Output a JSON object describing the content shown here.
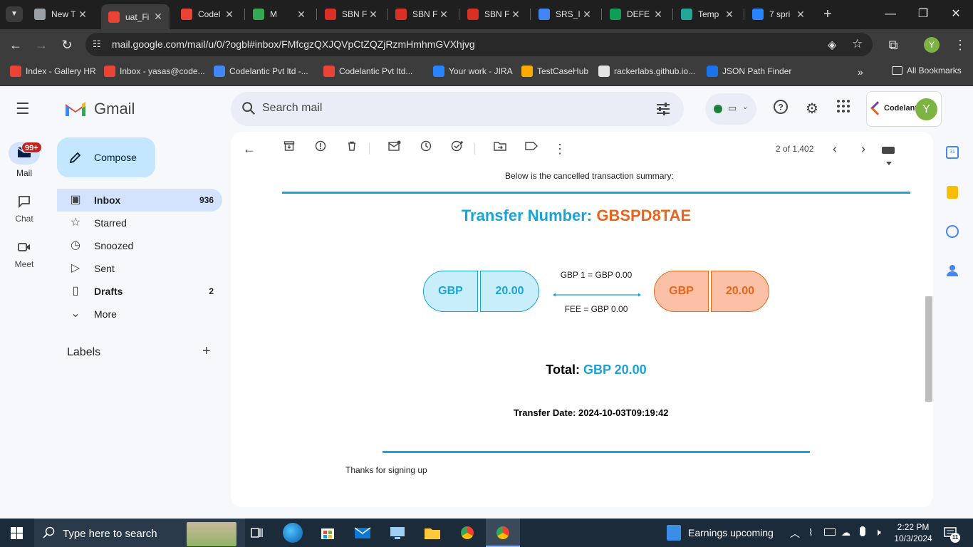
{
  "browser": {
    "tabs": [
      {
        "title": "New T",
        "color": "#9aa0a6"
      },
      {
        "title": "uat_Fi",
        "color": "#ea4335",
        "active": true
      },
      {
        "title": "Codel",
        "color": "#ea4335"
      },
      {
        "title": "M",
        "color": "#34a853"
      },
      {
        "title": "SBN F",
        "color": "#d93025"
      },
      {
        "title": "SBN F",
        "color": "#d93025"
      },
      {
        "title": "SBN F",
        "color": "#d93025"
      },
      {
        "title": "SRS_I",
        "color": "#4285f4"
      },
      {
        "title": "DEFE",
        "color": "#0f9d58"
      },
      {
        "title": "Temp",
        "color": "#26a69a"
      },
      {
        "title": "7 spri",
        "color": "#2684ff"
      }
    ],
    "url": "mail.google.com/mail/u/0/?ogbl#inbox/FMfcgzQXJQVpCtZQZjRzmHmhmGVXhjvg",
    "profile_initial": "Y",
    "bookmarks": [
      {
        "label": "Index - Gallery HR",
        "color": "#ea4335"
      },
      {
        "label": "Inbox - yasas@code...",
        "color": "#ea4335"
      },
      {
        "label": "Codelantic Pvt ltd -...",
        "color": "#4285f4"
      },
      {
        "label": "Codelantic Pvt ltd...",
        "color": "#ea4335"
      },
      {
        "label": "Your work - JIRA",
        "color": "#2684ff"
      },
      {
        "label": "TestCaseHub",
        "color": "#f9ab00"
      },
      {
        "label": "rackerlabs.github.io...",
        "color": "#e3e3e3"
      },
      {
        "label": "JSON Path Finder",
        "color": "#1a73e8"
      }
    ],
    "all_bookmarks": "All Bookmarks"
  },
  "gmail": {
    "brand": "Gmail",
    "search_placeholder": "Search mail",
    "rail": [
      {
        "label": "Mail",
        "badge": "99+"
      },
      {
        "label": "Chat"
      },
      {
        "label": "Meet"
      }
    ],
    "compose": "Compose",
    "nav": [
      {
        "label": "Inbox",
        "count": "936",
        "bold": true,
        "selected": true,
        "icon": "inbox-icon"
      },
      {
        "label": "Starred",
        "count": "",
        "icon": "star-icon"
      },
      {
        "label": "Snoozed",
        "count": "",
        "icon": "clock-icon"
      },
      {
        "label": "Sent",
        "count": "",
        "icon": "send-icon"
      },
      {
        "label": "Drafts",
        "count": "2",
        "bold": true,
        "icon": "draft-icon"
      },
      {
        "label": "More",
        "count": "",
        "icon": "chevron-down-icon"
      }
    ],
    "labels_heading": "Labels",
    "account_logo": "Codelantic",
    "account_initial": "Y",
    "pager": "2 of 1,402"
  },
  "email": {
    "intro": "Below is the cancelled transaction summary:",
    "transfer_label": "Transfer Number:",
    "transfer_number": "GBSPD8TAE",
    "from_currency": "GBP",
    "from_amount": "20.00",
    "rate": "GBP 1 = GBP 0.00",
    "fee": "FEE = GBP 0.00",
    "to_currency": "GBP",
    "to_amount": "20.00",
    "total_label": "Total:",
    "total_value": "GBP 20.00",
    "date_label": "Transfer Date:",
    "date_value": "2024-10-03T09:19:42",
    "footer": "Thanks for signing up"
  },
  "taskbar": {
    "search_placeholder": "Type here to search",
    "news": "Earnings upcoming",
    "time": "2:22 PM",
    "date": "10/3/2024",
    "notifications": "11"
  },
  "colors": {
    "accent_blue": "#1aa3d6",
    "accent_orange": "#e8651b",
    "blue_pill": "#c8eefa",
    "orange_pill": "#fbc1a6"
  }
}
